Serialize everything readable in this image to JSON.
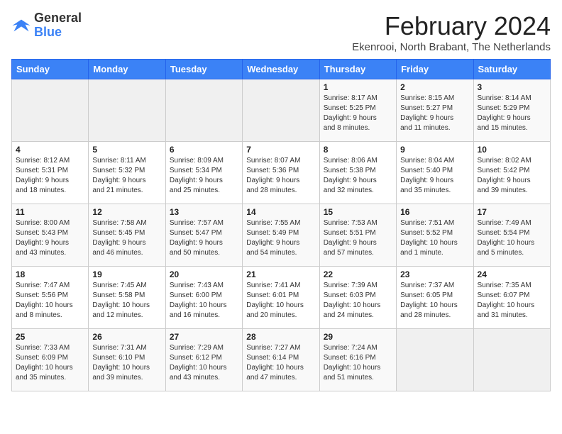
{
  "header": {
    "logo_general": "General",
    "logo_blue": "Blue",
    "title": "February 2024",
    "subtitle": "Ekenrooi, North Brabant, The Netherlands"
  },
  "days_of_week": [
    "Sunday",
    "Monday",
    "Tuesday",
    "Wednesday",
    "Thursday",
    "Friday",
    "Saturday"
  ],
  "weeks": [
    [
      {
        "day": "",
        "info": ""
      },
      {
        "day": "",
        "info": ""
      },
      {
        "day": "",
        "info": ""
      },
      {
        "day": "",
        "info": ""
      },
      {
        "day": "1",
        "info": "Sunrise: 8:17 AM\nSunset: 5:25 PM\nDaylight: 9 hours\nand 8 minutes."
      },
      {
        "day": "2",
        "info": "Sunrise: 8:15 AM\nSunset: 5:27 PM\nDaylight: 9 hours\nand 11 minutes."
      },
      {
        "day": "3",
        "info": "Sunrise: 8:14 AM\nSunset: 5:29 PM\nDaylight: 9 hours\nand 15 minutes."
      }
    ],
    [
      {
        "day": "4",
        "info": "Sunrise: 8:12 AM\nSunset: 5:31 PM\nDaylight: 9 hours\nand 18 minutes."
      },
      {
        "day": "5",
        "info": "Sunrise: 8:11 AM\nSunset: 5:32 PM\nDaylight: 9 hours\nand 21 minutes."
      },
      {
        "day": "6",
        "info": "Sunrise: 8:09 AM\nSunset: 5:34 PM\nDaylight: 9 hours\nand 25 minutes."
      },
      {
        "day": "7",
        "info": "Sunrise: 8:07 AM\nSunset: 5:36 PM\nDaylight: 9 hours\nand 28 minutes."
      },
      {
        "day": "8",
        "info": "Sunrise: 8:06 AM\nSunset: 5:38 PM\nDaylight: 9 hours\nand 32 minutes."
      },
      {
        "day": "9",
        "info": "Sunrise: 8:04 AM\nSunset: 5:40 PM\nDaylight: 9 hours\nand 35 minutes."
      },
      {
        "day": "10",
        "info": "Sunrise: 8:02 AM\nSunset: 5:42 PM\nDaylight: 9 hours\nand 39 minutes."
      }
    ],
    [
      {
        "day": "11",
        "info": "Sunrise: 8:00 AM\nSunset: 5:43 PM\nDaylight: 9 hours\nand 43 minutes."
      },
      {
        "day": "12",
        "info": "Sunrise: 7:58 AM\nSunset: 5:45 PM\nDaylight: 9 hours\nand 46 minutes."
      },
      {
        "day": "13",
        "info": "Sunrise: 7:57 AM\nSunset: 5:47 PM\nDaylight: 9 hours\nand 50 minutes."
      },
      {
        "day": "14",
        "info": "Sunrise: 7:55 AM\nSunset: 5:49 PM\nDaylight: 9 hours\nand 54 minutes."
      },
      {
        "day": "15",
        "info": "Sunrise: 7:53 AM\nSunset: 5:51 PM\nDaylight: 9 hours\nand 57 minutes."
      },
      {
        "day": "16",
        "info": "Sunrise: 7:51 AM\nSunset: 5:52 PM\nDaylight: 10 hours\nand 1 minute."
      },
      {
        "day": "17",
        "info": "Sunrise: 7:49 AM\nSunset: 5:54 PM\nDaylight: 10 hours\nand 5 minutes."
      }
    ],
    [
      {
        "day": "18",
        "info": "Sunrise: 7:47 AM\nSunset: 5:56 PM\nDaylight: 10 hours\nand 8 minutes."
      },
      {
        "day": "19",
        "info": "Sunrise: 7:45 AM\nSunset: 5:58 PM\nDaylight: 10 hours\nand 12 minutes."
      },
      {
        "day": "20",
        "info": "Sunrise: 7:43 AM\nSunset: 6:00 PM\nDaylight: 10 hours\nand 16 minutes."
      },
      {
        "day": "21",
        "info": "Sunrise: 7:41 AM\nSunset: 6:01 PM\nDaylight: 10 hours\nand 20 minutes."
      },
      {
        "day": "22",
        "info": "Sunrise: 7:39 AM\nSunset: 6:03 PM\nDaylight: 10 hours\nand 24 minutes."
      },
      {
        "day": "23",
        "info": "Sunrise: 7:37 AM\nSunset: 6:05 PM\nDaylight: 10 hours\nand 28 minutes."
      },
      {
        "day": "24",
        "info": "Sunrise: 7:35 AM\nSunset: 6:07 PM\nDaylight: 10 hours\nand 31 minutes."
      }
    ],
    [
      {
        "day": "25",
        "info": "Sunrise: 7:33 AM\nSunset: 6:09 PM\nDaylight: 10 hours\nand 35 minutes."
      },
      {
        "day": "26",
        "info": "Sunrise: 7:31 AM\nSunset: 6:10 PM\nDaylight: 10 hours\nand 39 minutes."
      },
      {
        "day": "27",
        "info": "Sunrise: 7:29 AM\nSunset: 6:12 PM\nDaylight: 10 hours\nand 43 minutes."
      },
      {
        "day": "28",
        "info": "Sunrise: 7:27 AM\nSunset: 6:14 PM\nDaylight: 10 hours\nand 47 minutes."
      },
      {
        "day": "29",
        "info": "Sunrise: 7:24 AM\nSunset: 6:16 PM\nDaylight: 10 hours\nand 51 minutes."
      },
      {
        "day": "",
        "info": ""
      },
      {
        "day": "",
        "info": ""
      }
    ]
  ]
}
